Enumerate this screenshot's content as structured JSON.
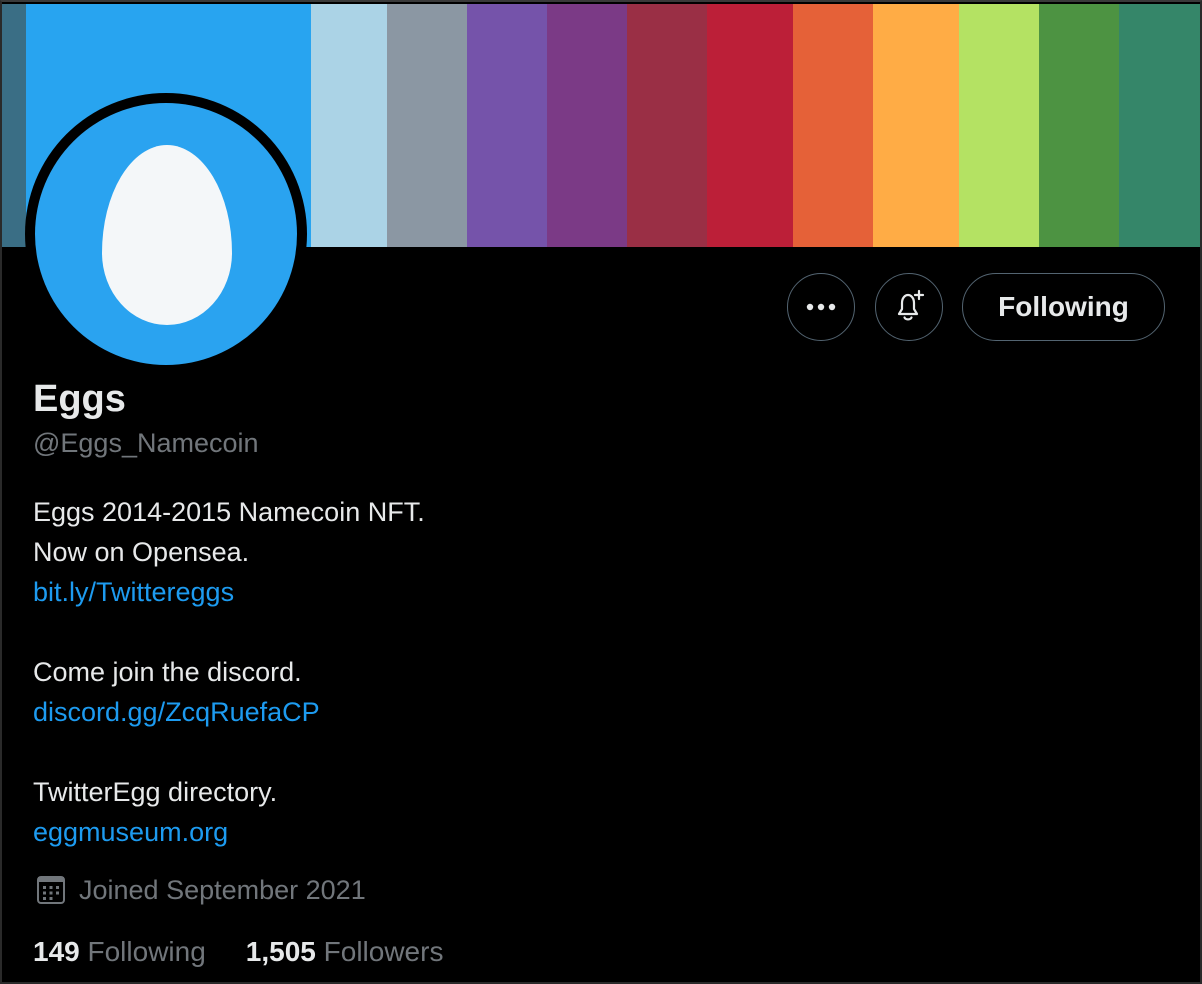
{
  "banner": {
    "colors": [
      "#3a6e85",
      "#28a4f0",
      "#28a4f0",
      "#28a4f0",
      "#abd3e6",
      "#8b97a3",
      "#7553aa",
      "#7b3a86",
      "#9a2f45",
      "#bc1f38",
      "#e56138",
      "#ffac45",
      "#b4e263",
      "#4d9342",
      "#358669"
    ]
  },
  "profile": {
    "avatar_icon": "egg-icon",
    "display_name": "Eggs",
    "handle": "@Eggs_Namecoin",
    "bio": [
      {
        "text": "Eggs 2014-2015 Namecoin NFT.",
        "type": "text"
      },
      {
        "text": "Now on Opensea.",
        "type": "text"
      },
      {
        "text": "bit.ly/Twittereggs",
        "type": "link"
      },
      {
        "text": "",
        "type": "blank"
      },
      {
        "text": "Come join the discord.",
        "type": "text"
      },
      {
        "text": "discord.gg/ZcqRuefaCP",
        "type": "link"
      },
      {
        "text": "",
        "type": "blank"
      },
      {
        "text": "TwitterEgg directory.",
        "type": "text"
      },
      {
        "text": "eggmuseum.org",
        "type": "link"
      }
    ],
    "joined": "Joined September 2021",
    "joined_icon": "calendar-icon"
  },
  "actions": {
    "more_icon": "more-icon",
    "bell_icon": "notification-bell-icon",
    "following_label": "Following"
  },
  "stats": {
    "following_count": "149",
    "following_label": "Following",
    "followers_count": "1,505",
    "followers_label": "Followers"
  },
  "colors": {
    "background": "#000000",
    "text": "#e7e9ea",
    "muted": "#71767b",
    "link": "#1d9bf0",
    "avatar_bg": "#2aa3f0"
  }
}
